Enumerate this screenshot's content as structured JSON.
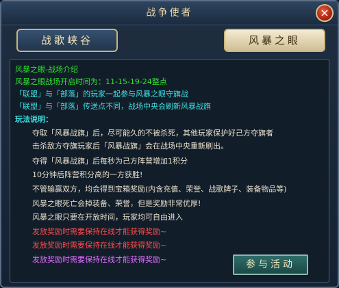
{
  "window": {
    "title": "战争使者",
    "close_symbol": "×"
  },
  "tabs": [
    {
      "label": "战歌峡谷",
      "selected": false
    },
    {
      "label": "风暴之眼",
      "selected": true
    }
  ],
  "content": {
    "intro_title": "风暴之眼-战场介绍",
    "open_time": "风暴之眼战场开启时间为：11-15-19-24整点",
    "info": [
      "「联盟」与「部落」的玩家一起参与风暴之眼守旗战",
      "「联盟」与「部落」传送点不同，战场中央会刷新风暴战旗"
    ],
    "rules_title": "玩法说明：",
    "rules": [
      "夺取「风暴战旗」后，尽可能久的不被杀死，其他玩家保护好己方夺旗者",
      "击杀敌方夺旗玩家后「风暴战旗」会在战场中央重新刷出。",
      "夺得「风暴战旗」后每秒为己方阵营增加1积分",
      "10分钟后阵营积分高的一方获胜!",
      "不管输赢双方，均会得到宝箱奖励(内含充值、荣誉、战歌牌子、装备物品等)",
      "风暴之眼死亡会掉装备、荣誉，但是奖励非常优厚!",
      "风暴之眼只要在开放时间，玩家均可自由进入"
    ],
    "reward_notes": [
      "发放奖励时需要保持在线才能获得奖励~",
      "发放奖励时需要保持在线才能获得奖励~",
      "发放奖励时需要保持在线才能获得奖励~"
    ]
  },
  "join_button": "参与活动",
  "colors": {
    "green": "#2fe32f",
    "cyan": "#3de0e0",
    "red": "#ff4a4a",
    "magenta": "#e06bff",
    "gold": "#c9b47c"
  }
}
